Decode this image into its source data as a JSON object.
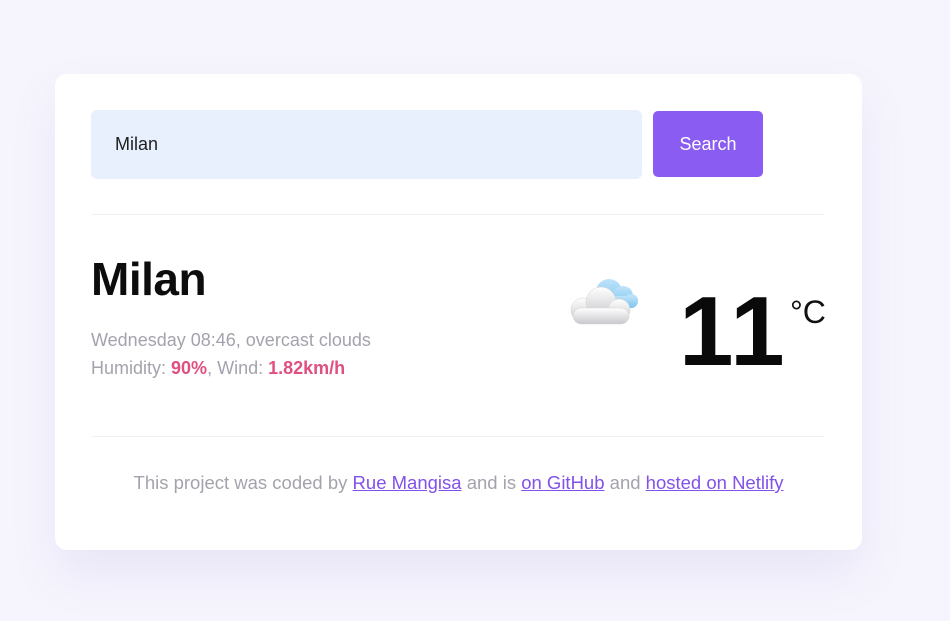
{
  "search": {
    "value": "Milan",
    "placeholder": "",
    "button_label": "Search"
  },
  "weather": {
    "city": "Milan",
    "day_time": "Wednesday 08:46",
    "description": "overcast clouds",
    "humidity_label": "Humidity:",
    "humidity": "90%",
    "wind_label": "Wind:",
    "wind": "1.82km/h",
    "temperature": "11",
    "unit": "°C",
    "icon": "cloud-icon"
  },
  "footer": {
    "text_1": "This project was coded by",
    "author_link": "Rue Mangisa",
    "text_2": "and is",
    "github_link": "on GitHub",
    "text_3": "and",
    "netlify_link": "hosted on Netlify"
  },
  "colors": {
    "accent": "#8b5cf1",
    "highlight": "#e0507f",
    "input_bg": "#e8effd",
    "link": "#8251ea",
    "muted_text": "#a3a3ad"
  }
}
